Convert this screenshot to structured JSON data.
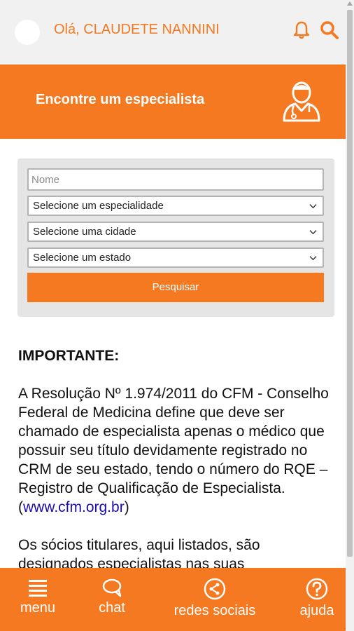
{
  "header": {
    "greeting": "Olá, CLAUDETE NANNINI",
    "bell_icon": "bell-icon",
    "search_icon": "search-icon"
  },
  "banner": {
    "title": "Encontre um especialista",
    "icon": "doctor-icon"
  },
  "form": {
    "name_placeholder": "Nome",
    "specialty_select": "Selecione um especialidade",
    "city_select": "Selecione uma cidade",
    "state_select": "Selecione um estado",
    "search_button": "Pesquisar"
  },
  "content": {
    "heading": "IMPORTANTE:",
    "paragraph1": "A Resolução Nº 1.974/2011 do CFM - Conselho Federal de Medicina define que deve ser chamado de especialista apenas o médico que possuir seu título devidamente registrado no CRM de seu estado, tendo o número do RQE – Registro de Qualificação de Especialista. (",
    "link_text": "www.cfm.org.br",
    "paragraph1_end": ")",
    "paragraph2": "Os sócios titulares, aqui listados, são designados especialistas nas suas"
  },
  "bottom_nav": {
    "menu": "menu",
    "chat": "chat",
    "social": "redes sociais",
    "help": "ajuda"
  },
  "colors": {
    "accent": "#f47920",
    "header_bg": "#f1f1f1",
    "panel_bg": "#e5e5e5"
  }
}
